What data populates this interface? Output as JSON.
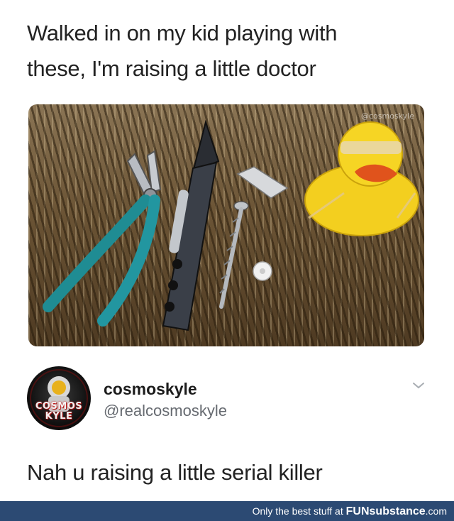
{
  "post": {
    "caption_line1": "Walked in on my kid playing with",
    "caption_line2": "these, I'm raising a little doctor",
    "photo_watermark": "@cosmoskyle"
  },
  "reply": {
    "avatar_logo_line1": "COSMOS",
    "avatar_logo_line2": "KYLE",
    "display_name": "cosmoskyle",
    "handle": "@realcosmoskyle",
    "text": "Nah u raising a little serial killer",
    "menu_icon": "chevron-down-icon"
  },
  "footer": {
    "prefix": "Only the best stuff at ",
    "brand_fun": "FUN",
    "brand_rest": "substance",
    "suffix": ".com"
  },
  "colors": {
    "footer_bar": "#2c4a73",
    "handle_gray": "#666a70",
    "text": "#222222"
  }
}
